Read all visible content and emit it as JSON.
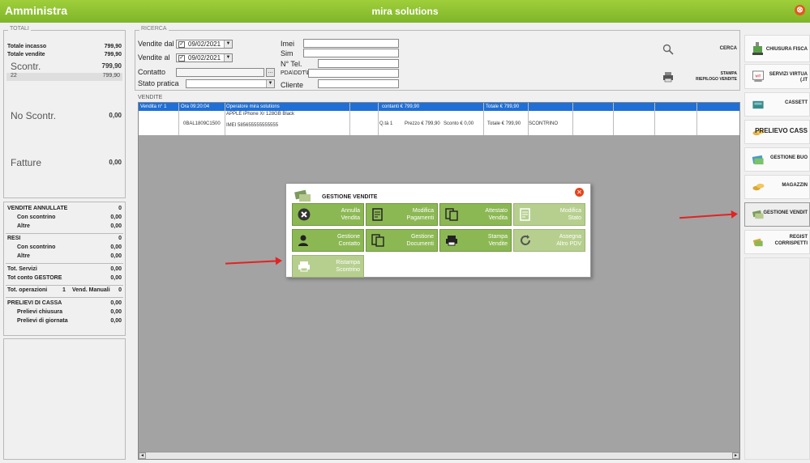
{
  "title": {
    "app": "Amministra",
    "center": "mira solutions",
    "close": "⊗"
  },
  "totali": {
    "label": "TOTALI",
    "incasso_l": "Totale incasso",
    "incasso_v": "799,90",
    "vendite_l": "Totale vendite",
    "vendite_v": "799,90",
    "scontr_l": "Scontr.",
    "scontr_v": "799,90",
    "scontr_sub_l": "22",
    "scontr_sub_v": "799,90",
    "noscontr_l": "No Scontr.",
    "noscontr_v": "0,00",
    "fatture_l": "Fatture",
    "fatture_v": "0,00"
  },
  "summary": {
    "annullate_l": "VENDITE ANNULLATE",
    "annullate_v": "0",
    "conscontrino_l": "Con scontrino",
    "conscontrino_v": "0,00",
    "altre_l": "Altre",
    "altre_v": "0,00",
    "resi_l": "RESI",
    "resi_v": "0",
    "resi_con_l": "Con scontrino",
    "resi_con_v": "0,00",
    "resi_altre_l": "Altre",
    "resi_altre_v": "0,00",
    "servizi_l": "Tot. Servizi",
    "servizi_v": "0,00",
    "gestore_l": "Tot conto GESTORE",
    "gestore_v": "0,00",
    "operazioni_l": "Tot. operazioni",
    "operazioni_v": "1",
    "manuali_l": "Vend. Manuali",
    "manuali_v": "0",
    "prelievi_l": "PRELIEVI DI CASSA",
    "prelievi_v": "0,00",
    "chiusura_l": "Prelievi chiusura",
    "chiusura_v": "0,00",
    "giornata_l": "Prelievi di giornata",
    "giornata_v": "0,00"
  },
  "ricerca": {
    "label": "RICERCA",
    "dal_l": "Vendite dal",
    "dal_v": "09/02/2021",
    "al_l": "Vendite al",
    "al_v": "09/02/2021",
    "contatto_l": "Contatto",
    "stato_l": "Stato pratica",
    "imei_l": "Imei",
    "sim_l": "Sim",
    "tel_l": "N° Tel.",
    "pda_l": "PDA\\DDT\\DT",
    "cliente_l": "Cliente",
    "cerca": "CERCA",
    "stampa1": "STAMPA",
    "stampa2": "RIEPILOGO VENDITE"
  },
  "vendite": {
    "label": "VENDITE",
    "h_num": "Vendita n° 1",
    "h_ora": "Ora 09:20:04",
    "h_op": "Operatore mira solutions",
    "h_cont": "contanti € 799,90",
    "h_tot": "Totale € 799,90",
    "code": "0BAL1809C1500",
    "prod": "APPLE iPhone Xr 128GB Black",
    "imei": "IMEI 585655555555555",
    "qta": "Q.tà 1",
    "prezzo": "Prezzo € 799,90",
    "sconto": "Sconto € 0,00",
    "totale": "Totale € 799,90",
    "tipo": "SCONTRINO"
  },
  "dialog": {
    "title": "GESTIONE VENDITE",
    "t1a": "Annulla",
    "t1b": "Vendita",
    "t2a": "Modifica",
    "t2b": "Pagamenti",
    "t3a": "Attestato",
    "t3b": "Vendita",
    "t4a": "Modifica",
    "t4b": "Stato",
    "t5a": "Gestione",
    "t5b": "Contatto",
    "t6a": "Gestione",
    "t6b": "Documenti",
    "t7a": "Stampa",
    "t7b": "Vendite",
    "t8a": "Assegna",
    "t8b": "Altro PDV",
    "t9a": "Ristampa",
    "t9b": "Scontrino"
  },
  "right": {
    "b1": "CHIUSURA FISCA",
    "b2a": "SERVIZI VIRTUA",
    "b2b": "(.IT",
    "b3": "CASSETT",
    "b4": "PRELIEVO CASS",
    "b5": "GESTIONE BUO",
    "b6": "MAGAZZIN",
    "b7": "GESTIONE VENDIT",
    "b8a": "REGIST",
    "b8b": "CORRISPETTI"
  },
  "colors": {
    "green": "#8cb854",
    "header_blue": "#1f6fd6",
    "arrow": "#e32222"
  }
}
